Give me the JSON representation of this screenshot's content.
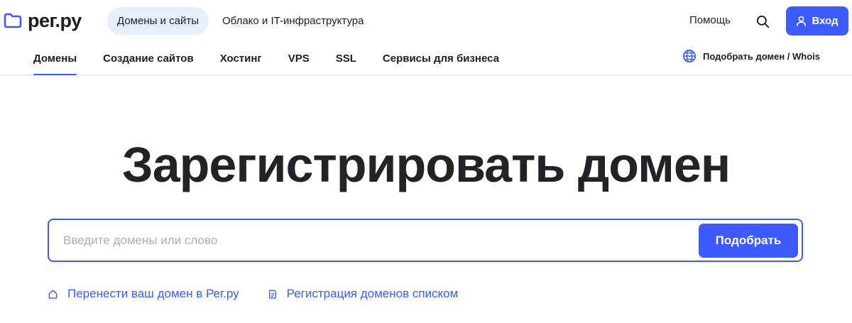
{
  "brand": {
    "logo_text": "рег.ру",
    "accent_color": "#3d5afe"
  },
  "header": {
    "top_tabs": [
      {
        "label": "Домены и сайты",
        "active": true
      },
      {
        "label": "Облако и IT-инфраструктура",
        "active": false
      }
    ],
    "help_label": "Помощь",
    "search_icon": "search-icon",
    "login_label": "Вход",
    "login_icon": "user-icon"
  },
  "sub_nav": {
    "items": [
      {
        "label": "Домены",
        "active": true
      },
      {
        "label": "Создание сайтов",
        "active": false
      },
      {
        "label": "Хостинг",
        "active": false
      },
      {
        "label": "VPS",
        "active": false
      },
      {
        "label": "SSL",
        "active": false
      },
      {
        "label": "Сервисы для бизнеса",
        "active": false
      }
    ],
    "whois_label": "Подобрать домен / Whois",
    "whois_icon": "globe-icon"
  },
  "hero": {
    "title": "Зарегистрировать домен",
    "search_placeholder": "Введите домены или слово",
    "search_value": "",
    "submit_label": "Подобрать",
    "links": [
      {
        "label": "Перенести ваш домен в Рег.ру",
        "icon": "home-icon"
      },
      {
        "label": "Регистрация доменов списком",
        "icon": "document-list-icon"
      }
    ]
  }
}
